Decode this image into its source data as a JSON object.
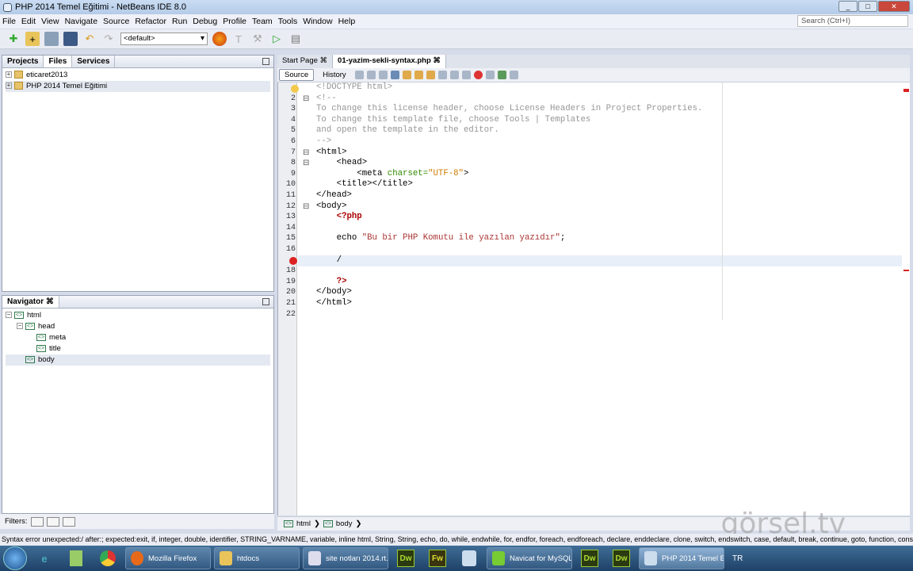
{
  "window": {
    "title": "PHP 2014 Temel Eğitimi - NetBeans IDE 8.0"
  },
  "menu": [
    "File",
    "Edit",
    "View",
    "Navigate",
    "Source",
    "Refactor",
    "Run",
    "Debug",
    "Profile",
    "Team",
    "Tools",
    "Window",
    "Help"
  ],
  "search": {
    "placeholder": "Search (Ctrl+I)"
  },
  "toolbar": {
    "config": "<default>"
  },
  "projects": {
    "tabs": [
      "Projects",
      "Files",
      "Services"
    ],
    "items": [
      "eticaret2013",
      "PHP 2014 Temel Eğitimi"
    ]
  },
  "navigator": {
    "title": "Navigator",
    "items": [
      "html",
      "head",
      "meta",
      "title",
      "body"
    ]
  },
  "filters": {
    "label": "Filters:"
  },
  "editor": {
    "tabs": [
      "Start Page",
      "01-yazim-sekli-syntax.php"
    ],
    "views": [
      "Source",
      "History"
    ],
    "lines": [
      [
        [
          "<!DOCTYPE html>",
          "com"
        ]
      ],
      [
        [
          "<!--",
          "com"
        ]
      ],
      [
        [
          "To change this license header, choose License Headers in Project Properties.",
          "com"
        ]
      ],
      [
        [
          "To change this template file, choose Tools | Templates",
          "com"
        ]
      ],
      [
        [
          "and open the template in the editor.",
          "com"
        ]
      ],
      [
        [
          "-->",
          "com"
        ]
      ],
      [
        [
          "<html>",
          "tag"
        ]
      ],
      [
        [
          "    <head>",
          "tag"
        ]
      ],
      [
        [
          "        <meta ",
          "tag"
        ],
        [
          "charset=",
          "attr"
        ],
        [
          "\"UTF-8\"",
          "val"
        ],
        [
          ">",
          "tag"
        ]
      ],
      [
        [
          "    <title></title>",
          "tag"
        ]
      ],
      [
        [
          "</head>",
          "tag"
        ]
      ],
      [
        [
          "<body>",
          "tag"
        ]
      ],
      [
        [
          "    <?php",
          "php"
        ]
      ],
      [
        [
          "",
          "plain"
        ]
      ],
      [
        [
          "    echo ",
          "plain"
        ],
        [
          "\"Bu bir PHP Komutu ile yazılan yazıdır\"",
          "str"
        ],
        [
          ";",
          "plain"
        ]
      ],
      [
        [
          "",
          "plain"
        ]
      ],
      [
        [
          "    /",
          "plain"
        ]
      ],
      [
        [
          "",
          "plain"
        ]
      ],
      [
        [
          "    ?>",
          "php"
        ]
      ],
      [
        [
          "</body>",
          "tag"
        ]
      ],
      [
        [
          "</html>",
          "tag"
        ]
      ],
      [
        [
          "",
          "plain"
        ]
      ]
    ],
    "breadcrumb": [
      "html",
      "body"
    ]
  },
  "status": {
    "text": "Syntax error  unexpected:/  after:;  expected:exit, if, integer, double, identifier, STRING_VARNAME, variable, inline html, String, String, echo, do, while, endwhile, for, endfor, foreach, endforeach, declare, enddeclare, clone, switch, endswitch, case, default, break, continue, goto, function, const,"
  },
  "taskbar": {
    "items": [
      "Mozilla Firefox",
      "htdocs",
      "site notları 2014.rt...",
      "Navicat for MySQL",
      "PHP 2014 Temel E..."
    ],
    "lang": "TR"
  },
  "watermark": "görsel.tv"
}
